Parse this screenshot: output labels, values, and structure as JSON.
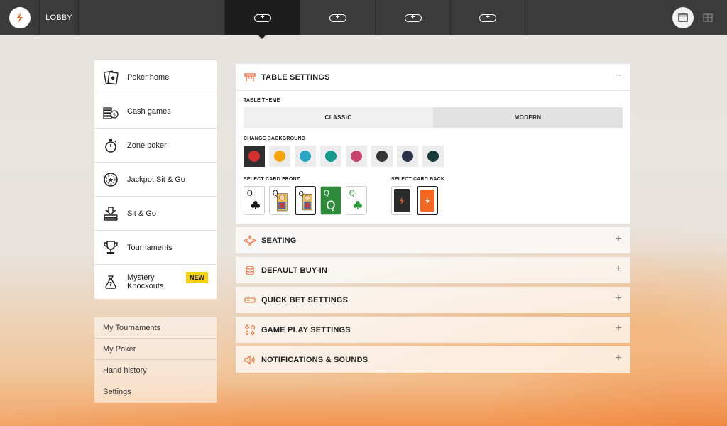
{
  "topbar": {
    "lobby_label": "LOBBY",
    "table_slots": [
      "+",
      "+",
      "+",
      "+"
    ],
    "active_slot": 0,
    "view_modes": [
      "single-view",
      "grid-view"
    ]
  },
  "sidebar": {
    "items": [
      {
        "label": "Poker home",
        "icon": "poker-home-icon"
      },
      {
        "label": "Cash games",
        "icon": "cash-games-icon"
      },
      {
        "label": "Zone poker",
        "icon": "stopwatch-icon"
      },
      {
        "label": "Jackpot Sit & Go",
        "icon": "jackpot-icon"
      },
      {
        "label": "Sit & Go",
        "icon": "sit-and-go-icon"
      },
      {
        "label": "Tournaments",
        "icon": "trophy-icon"
      },
      {
        "label": "Mystery Knockouts",
        "icon": "mystery-bag-icon",
        "badge": "NEW"
      }
    ],
    "links": [
      "My Tournaments",
      "My Poker",
      "Hand history",
      "Settings"
    ]
  },
  "settings": {
    "table_settings": {
      "title": "TABLE SETTINGS",
      "toggle": "−",
      "theme_label": "TABLE THEME",
      "theme_options": [
        "CLASSIC",
        "MODERN"
      ],
      "background_label": "CHANGE BACKGROUND",
      "backgrounds": [
        "#d32f2f",
        "#f7a50c",
        "#2aa5c5",
        "#17998c",
        "#c9446c",
        "#353535",
        "#2b3148",
        "#163a37"
      ],
      "selected_background": 0,
      "card_front_label": "SELECT CARD FRONT",
      "card_back_label": "SELECT CARD BACK",
      "card_fronts": [
        {
          "rank": "Q",
          "style": "classic"
        },
        {
          "rank": "Q",
          "style": "face"
        },
        {
          "rank": "Q",
          "style": "face-bordered"
        },
        {
          "rank": "Q",
          "style": "green"
        },
        {
          "rank": "Q",
          "style": "green-suit"
        }
      ],
      "selected_card_front": 2,
      "card_backs": [
        {
          "style": "dark"
        },
        {
          "style": "orange"
        }
      ],
      "selected_card_back": 1
    },
    "sections": [
      {
        "title": "SEATING",
        "icon": "seating-icon",
        "toggle": "+"
      },
      {
        "title": "DEFAULT BUY-IN",
        "icon": "chips-stack-icon",
        "toggle": "+"
      },
      {
        "title": "QUICK BET SETTINGS",
        "icon": "quick-bet-icon",
        "toggle": "+"
      },
      {
        "title": "GAME PLAY SETTINGS",
        "icon": "game-play-icon",
        "toggle": "+"
      },
      {
        "title": "NOTIFICATIONS & SOUNDS",
        "icon": "speaker-icon",
        "toggle": "+"
      }
    ]
  },
  "colors": {
    "topbar": "#3b3b3b",
    "accent_orange": "#f26722",
    "badge_yellow": "#f5d20d"
  }
}
